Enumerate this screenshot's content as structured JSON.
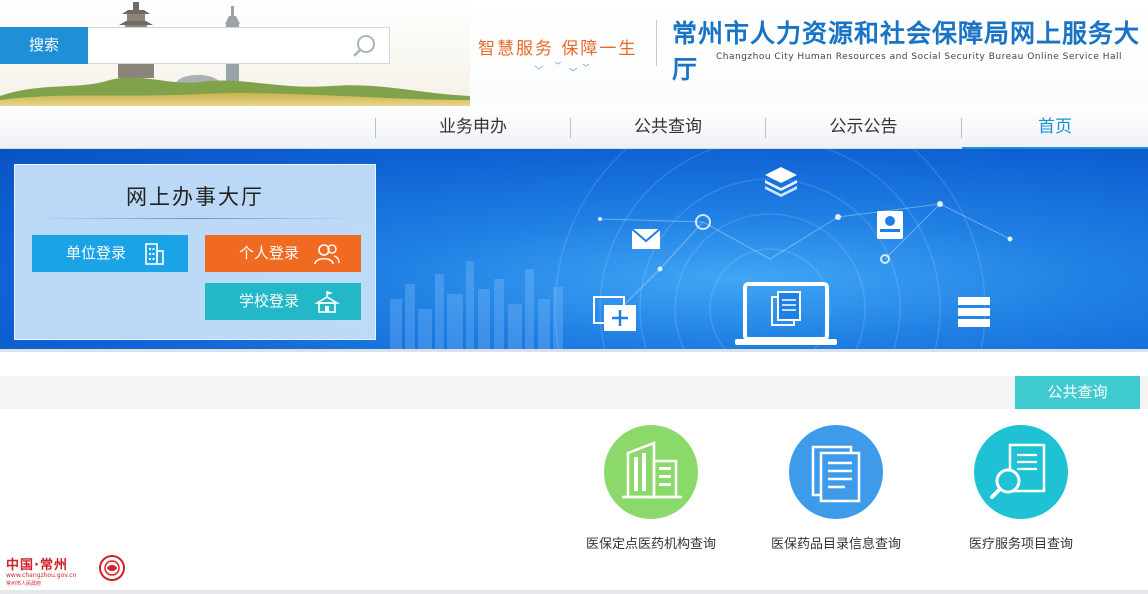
{
  "header": {
    "search": {
      "button_label": "搜索",
      "value": "",
      "placeholder": ""
    },
    "slogan": "智慧服务  保障一生",
    "title": "常州市人力资源和社会保障局网上服务大厅",
    "subtitle": "Changzhou City Human Resources and Social Security Bureau Online Service Hall"
  },
  "nav": {
    "items": [
      {
        "label": "业务申办"
      },
      {
        "label": "公共查询"
      },
      {
        "label": "公示公告"
      },
      {
        "label": "首页",
        "active": true
      }
    ]
  },
  "login_panel": {
    "title": "网上办事大厅",
    "buttons": {
      "unit": "单位登录",
      "personal": "个人登录",
      "school": "学校登录"
    }
  },
  "public_query": {
    "tab_label": "公共查询",
    "cards": [
      {
        "label": "医保定点医药机构查询",
        "icon": "building-icon",
        "color": "#8cd96b"
      },
      {
        "label": "医保药品目录信息查询",
        "icon": "document-list-icon",
        "color": "#3d9be9"
      },
      {
        "label": "医疗服务项目查询",
        "icon": "document-search-icon",
        "color": "#1fc2d4"
      }
    ]
  },
  "footer": {
    "logo_text": "中国·常州",
    "logo_url": "www.changzhou.gov.cn",
    "logo_sub": "常州市人民政府"
  },
  "colors": {
    "primary_blue": "#1f8fd6",
    "orange": "#f06a22",
    "teal": "#22b8c8",
    "banner_blue": "#1f7fe3"
  }
}
